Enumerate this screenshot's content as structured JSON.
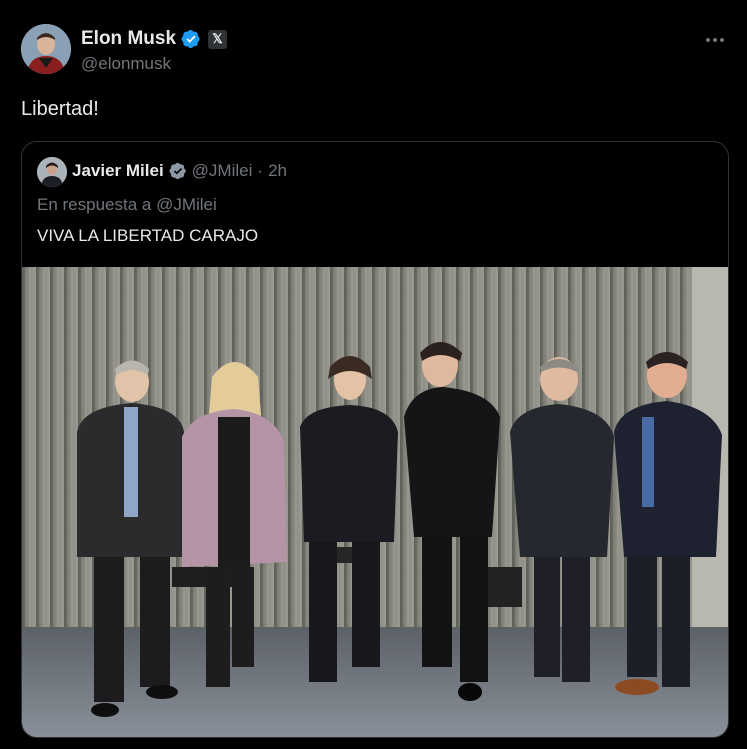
{
  "tweet": {
    "author_name": "Elon Musk",
    "author_handle": "@elonmusk",
    "text": "Libertad!",
    "verified_color": "#1d9bf0",
    "badge_label": "𝕏"
  },
  "quote": {
    "author_name": "Javier Milei",
    "author_handle": "@JMilei",
    "separator": "·",
    "time": "2h",
    "reply_to": "En respuesta a @JMilei",
    "text": "VIVA LA LIBERTAD CARAJO"
  },
  "icons": [
    "verified-icon",
    "x-logo-icon",
    "more-icon"
  ]
}
